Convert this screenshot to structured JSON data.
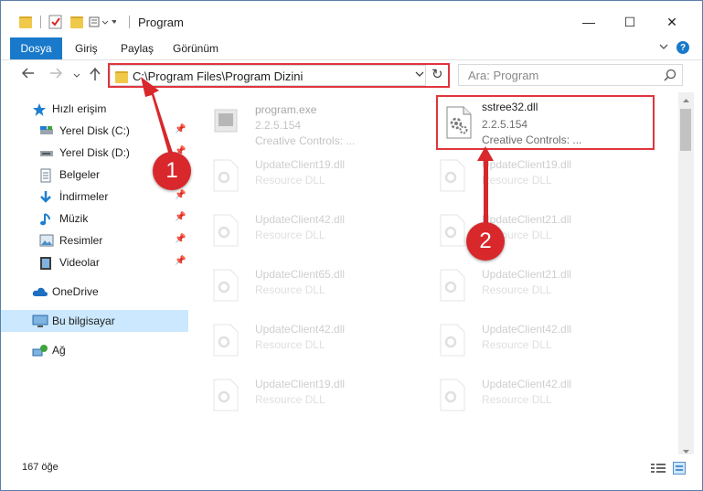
{
  "window": {
    "title": "Program",
    "controls": {
      "minimize": "—",
      "maximize": "☐",
      "close": "✕"
    }
  },
  "ribbon": {
    "tabs": [
      "Dosya",
      "Giriş",
      "Paylaş",
      "Görünüm"
    ],
    "help": "?"
  },
  "address": {
    "path": "C:\\Program Files\\Program Dizini",
    "refresh_icon": "↻",
    "dropdown_icon": "⌄"
  },
  "search": {
    "placeholder": "Ara: Program"
  },
  "sidebar": {
    "quick_access": "Hızlı erişim",
    "items": [
      {
        "label": "Yerel Disk (C:)",
        "icon": "drive-icon"
      },
      {
        "label": "Yerel Disk (D:)",
        "icon": "drive-icon"
      },
      {
        "label": "Belgeler",
        "icon": "documents-icon"
      },
      {
        "label": "İndirmeler",
        "icon": "download-icon"
      },
      {
        "label": "Müzik",
        "icon": "music-icon"
      },
      {
        "label": "Resimler",
        "icon": "pictures-icon"
      },
      {
        "label": "Videolar",
        "icon": "videos-icon"
      }
    ],
    "onedrive": "OneDrive",
    "this_pc": "Bu bilgisayar",
    "network": "Ağ"
  },
  "files": {
    "highlighted": {
      "name": "sstree32.dll",
      "version": "2.2.5.154",
      "company": "Creative Controls: ..."
    },
    "program": {
      "name": "program.exe",
      "version": "2.2.5.154",
      "company": "Creative Controls: ..."
    },
    "left_column": [
      {
        "name": "UpdateClient19.dll",
        "type": "Resource DLL"
      },
      {
        "name": "UpdateClient42.dll",
        "type": "Resource DLL"
      },
      {
        "name": "UpdateClient65.dll",
        "type": "Resource DLL"
      },
      {
        "name": "UpdateClient42.dll",
        "type": "Resource DLL"
      },
      {
        "name": "UpdateClient19.dll",
        "type": "Resource DLL"
      }
    ],
    "right_column": [
      {
        "name": "UpdateClient19.dll",
        "type": "Resource DLL"
      },
      {
        "name": "UpdateClient21.dll",
        "type": "Resource DLL"
      },
      {
        "name": "UpdateClient21.dll",
        "type": "Resource DLL"
      },
      {
        "name": "UpdateClient42.dll",
        "type": "Resource DLL"
      },
      {
        "name": "UpdateClient42.dll",
        "type": "Resource DLL"
      }
    ]
  },
  "status": {
    "count": "167 öğe"
  },
  "annotations": {
    "step1": "1",
    "step2": "2",
    "color": "#d8282c"
  }
}
